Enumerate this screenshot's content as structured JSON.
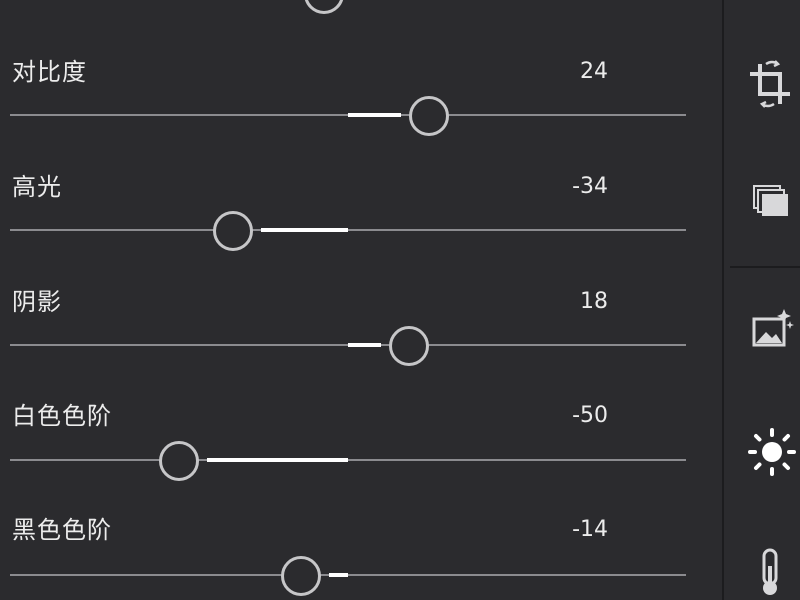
{
  "adjustments": [
    {
      "label": "对比度",
      "value": "24",
      "level": 24
    },
    {
      "label": "高光",
      "value": "-34",
      "level": -34
    },
    {
      "label": "阴影",
      "value": "18",
      "level": 18
    },
    {
      "label": "白色色阶",
      "value": "-50",
      "level": -50
    },
    {
      "label": "黑色色阶",
      "value": "-14",
      "level": -14
    }
  ],
  "top_partial_slider": {
    "level": -7
  },
  "rail_tools": [
    {
      "name": "crop-rotate-icon"
    },
    {
      "name": "presets-icon"
    },
    {
      "name": "enhance-image-icon"
    },
    {
      "name": "light-icon",
      "active": true
    },
    {
      "name": "color-temperature-icon"
    }
  ],
  "colors": {
    "background": "#2b2b2e",
    "track": "#8b8b8f",
    "fill": "#ffffff",
    "knob": "#c6c6c8",
    "text": "#ececec"
  }
}
